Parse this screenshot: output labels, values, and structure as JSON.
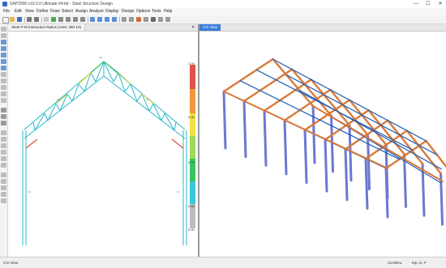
{
  "window": {
    "title": "SAP2000 v19.0.0 Ultimate 64-bit - Steel Structure Design",
    "minimize": "—",
    "maximize": "☐",
    "close": "✕"
  },
  "menu": [
    "File",
    "Edit",
    "View",
    "Define",
    "Draw",
    "Select",
    "Assign",
    "Analyze",
    "Display",
    "Design",
    "Options",
    "Tools",
    "Help"
  ],
  "left_pane": {
    "tab_label": "Steel P-M Interaction Ratios (AISC 360-10)",
    "close_glyph": "✕",
    "legend_ticks": [
      "1.00",
      "0.90",
      "0.70",
      "0.50",
      "0.00"
    ]
  },
  "right_pane": {
    "tab_label": "3-D View"
  },
  "status": {
    "left": "3-D View",
    "right_units": "GLOBAL",
    "right_units2": "Kip, in, F"
  },
  "colors": {
    "accent": "#3d7edb",
    "frame_cyan": "#28b8c8",
    "steel_orange": "#d97a3a",
    "column_blue": "#6c78d2",
    "legend": [
      "#e0534a",
      "#ee9a3c",
      "#f0e040",
      "#9fd85a",
      "#38c45e",
      "#3cc8dc",
      "#bcbcbc"
    ]
  }
}
